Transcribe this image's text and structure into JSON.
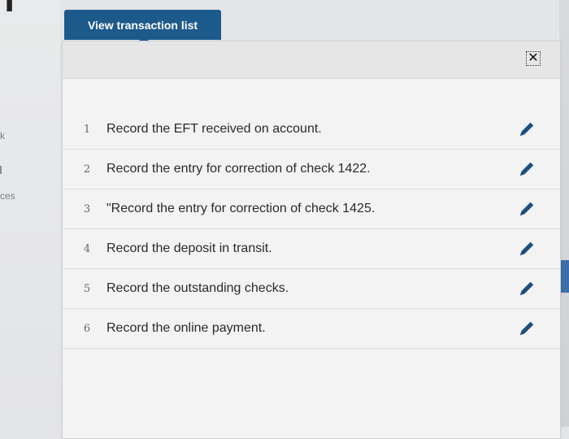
{
  "tab": {
    "label": "View transaction list"
  },
  "panel": {
    "close_symbol": "✕",
    "items": [
      {
        "num": "1",
        "label": "Record the EFT received on account."
      },
      {
        "num": "2",
        "label": "Record the entry for correction of check 1422."
      },
      {
        "num": "3",
        "label": "\"Record the entry for correction of check 1425."
      },
      {
        "num": "4",
        "label": "Record the deposit in transit."
      },
      {
        "num": "5",
        "label": "Record the outstanding checks."
      },
      {
        "num": "6",
        "label": "Record the online payment."
      }
    ]
  },
  "background": {
    "left_label_1": "k",
    "left_label_2": "ces"
  },
  "icons": {
    "edit": "pencil-icon",
    "close": "close-icon"
  },
  "colors": {
    "accent": "#1d5a8c",
    "edit_icon": "#1f4f7d"
  }
}
